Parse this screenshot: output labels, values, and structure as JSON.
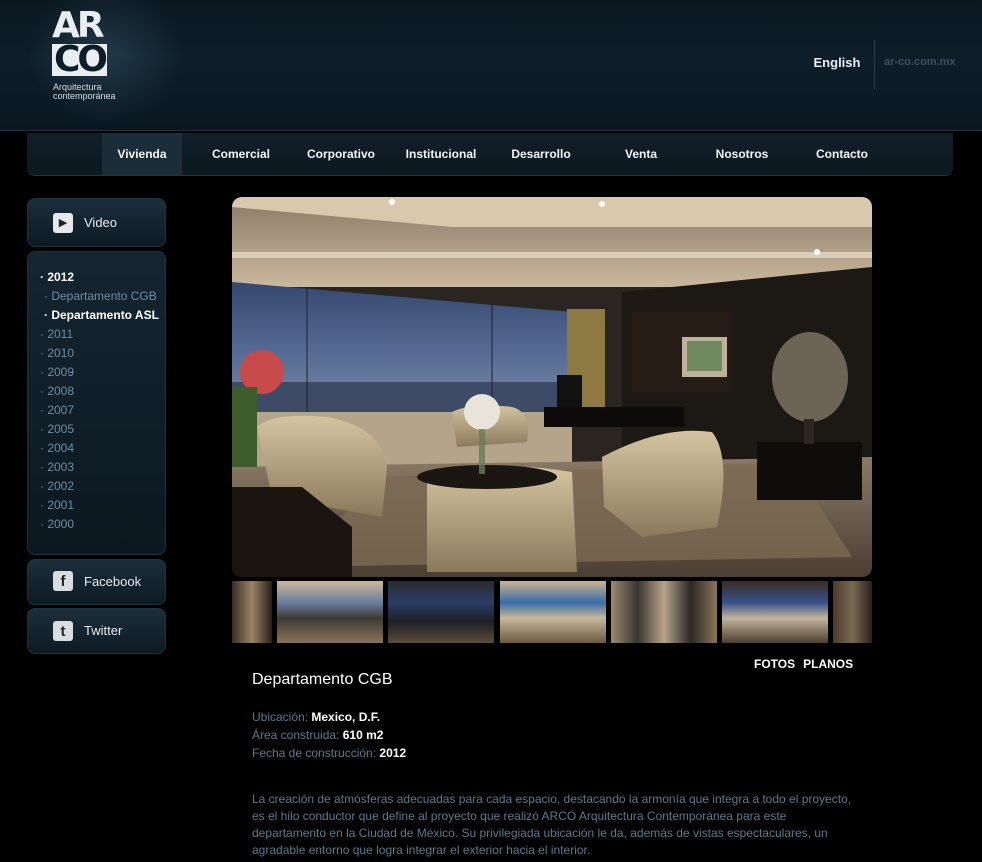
{
  "header": {
    "logo_top": "AR",
    "logo_bottom": "CO",
    "logo_caption_1": "Arquitectura",
    "logo_caption_2": "contemporánea",
    "language": "English",
    "domain": "ar-co.com.mx"
  },
  "nav": {
    "items": [
      {
        "label": "Vivienda"
      },
      {
        "label": "Comercial"
      },
      {
        "label": "Corporativo"
      },
      {
        "label": "Institucional"
      },
      {
        "label": "Desarrollo"
      },
      {
        "label": "Venta"
      },
      {
        "label": "Nosotros"
      },
      {
        "label": "Contacto"
      }
    ],
    "active": "Vivienda"
  },
  "sidebar": {
    "video_label": "Video",
    "facebook_label": "Facebook",
    "twitter_label": "Twitter",
    "years": [
      {
        "label": "· 2012"
      },
      {
        "label": "· Departamento CGB"
      },
      {
        "label": "· Departamento ASL"
      },
      {
        "label": "· 2011"
      },
      {
        "label": "· 2010"
      },
      {
        "label": "· 2009"
      },
      {
        "label": "· 2008"
      },
      {
        "label": "· 2007"
      },
      {
        "label": "· 2005"
      },
      {
        "label": "· 2004"
      },
      {
        "label": "· 2003"
      },
      {
        "label": "· 2002"
      },
      {
        "label": "· 2001"
      },
      {
        "label": "· 2000"
      }
    ]
  },
  "project": {
    "tabs": [
      "FOTOS",
      "PLANOS"
    ],
    "title": "Departamento CGB",
    "location_label": "Ubicación:",
    "location_value": "Mexico, D.F.",
    "area_label": "Área construida:",
    "area_value": "610 m2",
    "date_label": "Fecha de construcción:",
    "date_value": "2012",
    "description": "La creación de atmósferas adecuadas para cada espacio, destacando la armonía que integra a todo el proyecto, es el hilo conductor que define al proyecto que realizó ARCO Arquitectura Contemporánea para este departamento en la Ciudad de México. Su privilegiada ubicación le da, además de vistas espectaculares, un agradable entorno que logra integrar el exterior hacia el interior."
  },
  "colors": {
    "background": "#000000",
    "header": "#0d1e29",
    "muted_text": "#5d7a8c",
    "year_link": "#6f8ea2"
  }
}
